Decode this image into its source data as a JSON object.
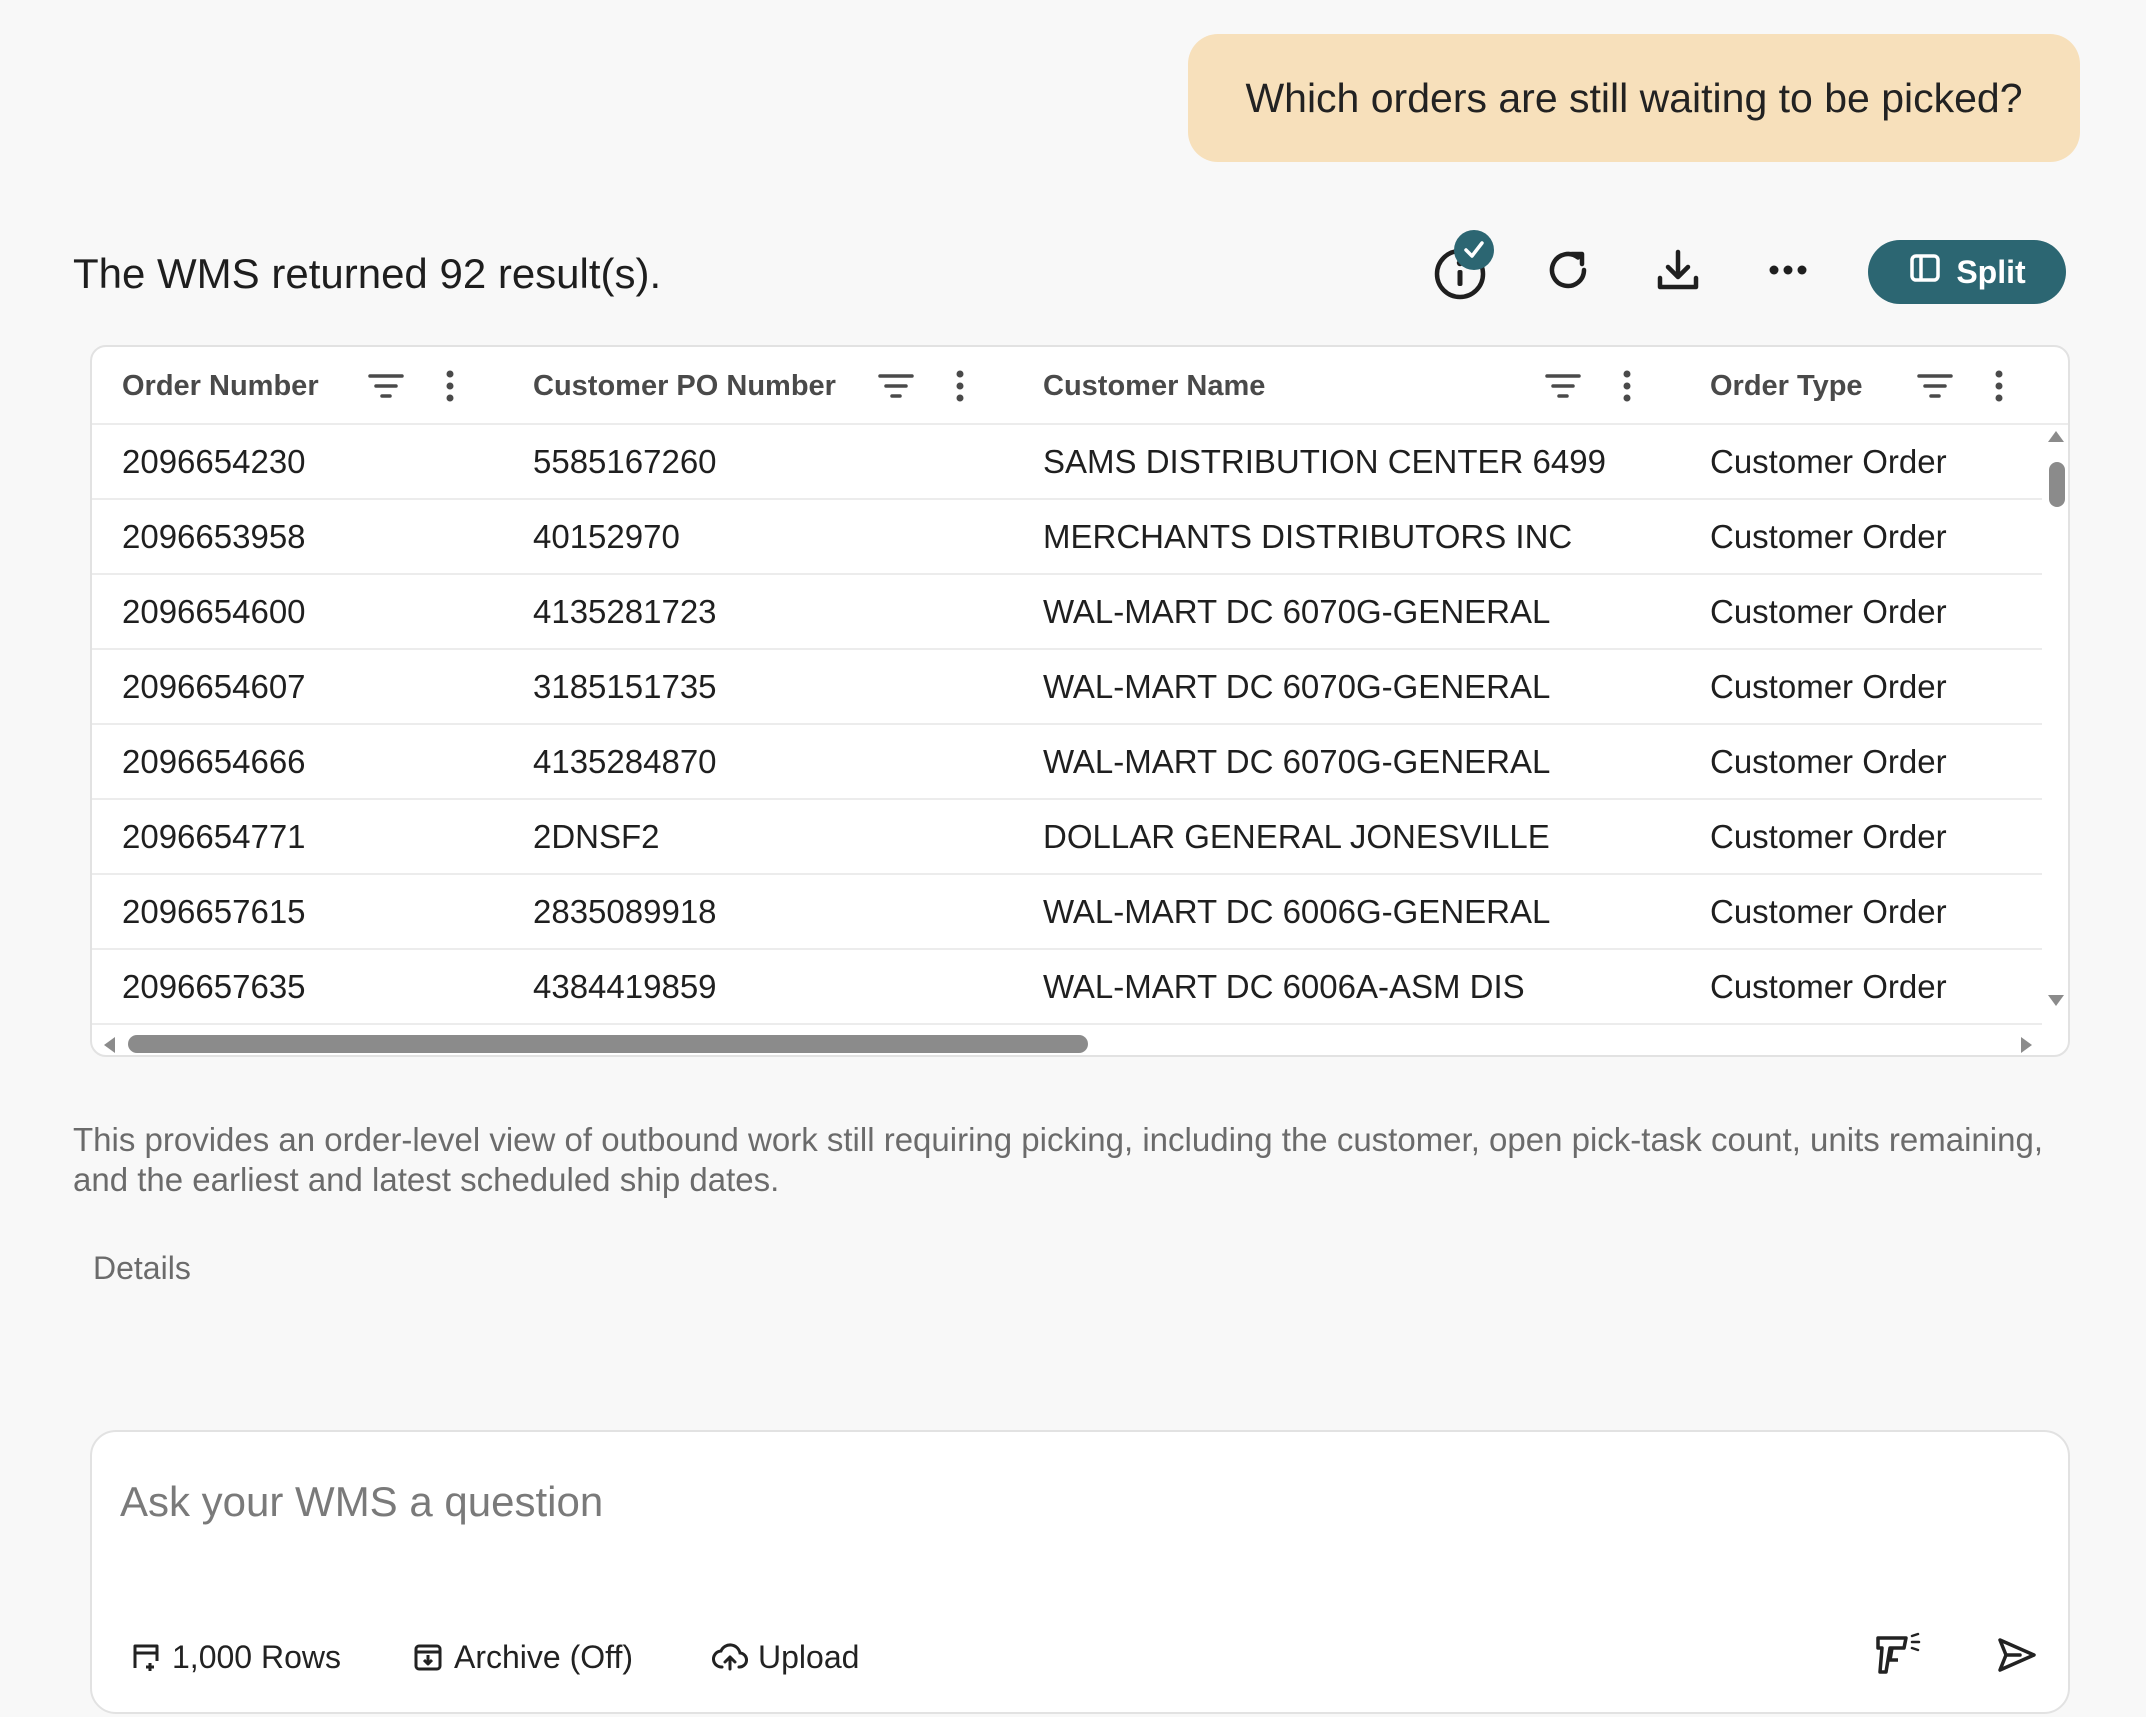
{
  "user_message": "Which orders are still waiting to be picked?",
  "result_summary": "The WMS returned 92 result(s).",
  "toolbar": {
    "info_icon": "info-icon",
    "refresh_icon": "refresh-icon",
    "download_icon": "download-icon",
    "more_icon": "more-horizontal-icon",
    "split_label": "Split"
  },
  "table": {
    "columns": [
      "Order Number",
      "Customer PO Number",
      "Customer Name",
      "Order Type"
    ],
    "rows": [
      [
        "2096654230",
        "5585167260",
        "SAMS DISTRIBUTION CENTER 6499",
        "Customer Order"
      ],
      [
        "2096653958",
        "40152970",
        "MERCHANTS DISTRIBUTORS INC",
        "Customer Order"
      ],
      [
        "2096654600",
        "4135281723",
        "WAL-MART DC 6070G-GENERAL",
        "Customer Order"
      ],
      [
        "2096654607",
        "3185151735",
        "WAL-MART DC 6070G-GENERAL",
        "Customer Order"
      ],
      [
        "2096654666",
        "4135284870",
        "WAL-MART DC 6070G-GENERAL",
        "Customer Order"
      ],
      [
        "2096654771",
        "2DNSF2",
        "DOLLAR GENERAL JONESVILLE",
        "Customer Order"
      ],
      [
        "2096657615",
        "2835089918",
        "WAL-MART DC 6006G-GENERAL",
        "Customer Order"
      ],
      [
        "2096657635",
        "4384419859",
        "WAL-MART DC 6006A-ASM DIS",
        "Customer Order"
      ]
    ]
  },
  "description": "This provides an order-level view of outbound work still requiring picking, including the customer, open pick-task count, units remaining, and the earliest and latest scheduled ship dates.",
  "details_label": "Details",
  "composer": {
    "placeholder": "Ask your WMS a question",
    "rows_label": "1,000 Rows",
    "archive_label": "Archive (Off)",
    "upload_label": "Upload"
  },
  "colors": {
    "accent": "#2c6672",
    "user_bubble": "#f7e0bb",
    "background": "#f8f8f8"
  }
}
